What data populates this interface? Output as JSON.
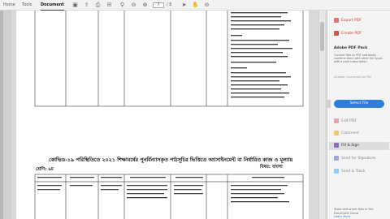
{
  "menubar": {
    "tabs": [
      "Home",
      "Tools",
      "Document"
    ],
    "page_current": "7",
    "page_total": "/ 8"
  },
  "icons": [
    "save-icon",
    "upload-icon",
    "print-icon",
    "envelope-icon",
    "search-icon",
    "prev-page-icon",
    "next-page-icon"
  ],
  "right_panel": {
    "export_pdf": "Export PDF",
    "create_pdf": "Create PDF",
    "pack_title": "Adobe PDF Pack",
    "pack_desc": "Convert files to PDF and easily combine them with other file types with a paid subscription",
    "already_link": "Already Converted to PDF",
    "select_file": "Select File",
    "edit_pdf": "Edit PDF",
    "comment": "Comment",
    "fill_sign": "Fill & Sign",
    "send_signature": "Send for Signature",
    "send_track": "Send & Track",
    "footer": "Store and share files in the Document Cloud",
    "learn_more": "Learn More",
    "accent": "#c0392b",
    "button_color": "#2d7ddb"
  },
  "page2": {
    "heading": "কোভিড-১৯ পরিস্থিতিতে ২০২১ শিক্ষাবর্ষের পুনর্বিন্যাসকৃত পাঠসূচির ভিত্তিতে অ্যাসাইনমেন্ট বা নির্ধারিত কাজ ও মূল্যায়ন নির্দেশনা",
    "class_label": "শ্রেণি: ৯ম",
    "subject_label": "বিষয়: বাংলা"
  }
}
